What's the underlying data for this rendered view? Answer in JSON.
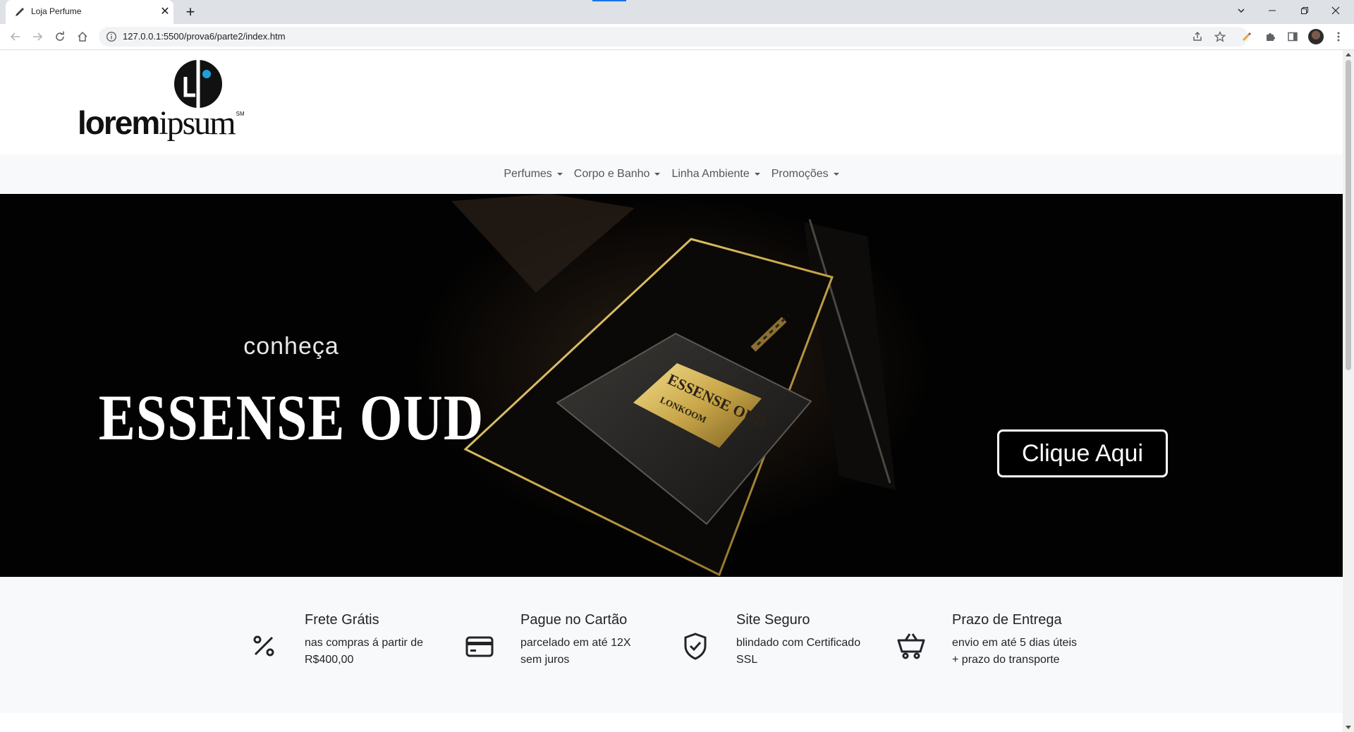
{
  "browser": {
    "tab_title": "Loja Perfume",
    "tab_close": "✕",
    "new_tab": "+",
    "url": "127.0.0.1:5500/prova6/parte2/index.htm"
  },
  "site": {
    "logo": {
      "bold": "lorem",
      "light": "ipsum",
      "mark": "SM"
    },
    "nav": [
      {
        "label": "Perfumes"
      },
      {
        "label": "Corpo e Banho"
      },
      {
        "label": "Linha Ambiente"
      },
      {
        "label": "Promoções"
      }
    ],
    "hero": {
      "intro": "conheça",
      "title": "ESSENSE OUD",
      "bottle_label_1": "ESSENSE OUD",
      "bottle_label_2": "LONKOOM",
      "cta": "Clique Aqui"
    },
    "features": [
      {
        "icon": "percent-icon",
        "title": "Frete Grátis",
        "text": "nas compras á partir de R$400,00"
      },
      {
        "icon": "credit-card-icon",
        "title": "Pague no Cartão",
        "text": "parcelado em até 12X sem juros"
      },
      {
        "icon": "shield-check-icon",
        "title": "Site Seguro",
        "text": "blindado com Certificado SSL"
      },
      {
        "icon": "cart-icon",
        "title": "Prazo de Entrega",
        "text": "envio em até 5 dias úteis + prazo do transporte"
      }
    ]
  },
  "colors": {
    "nav_background": "#f8f9fa",
    "hero_background": "#020202",
    "logo_accent": "#1ea0dc",
    "bottle_gold": "#c9a74a"
  }
}
